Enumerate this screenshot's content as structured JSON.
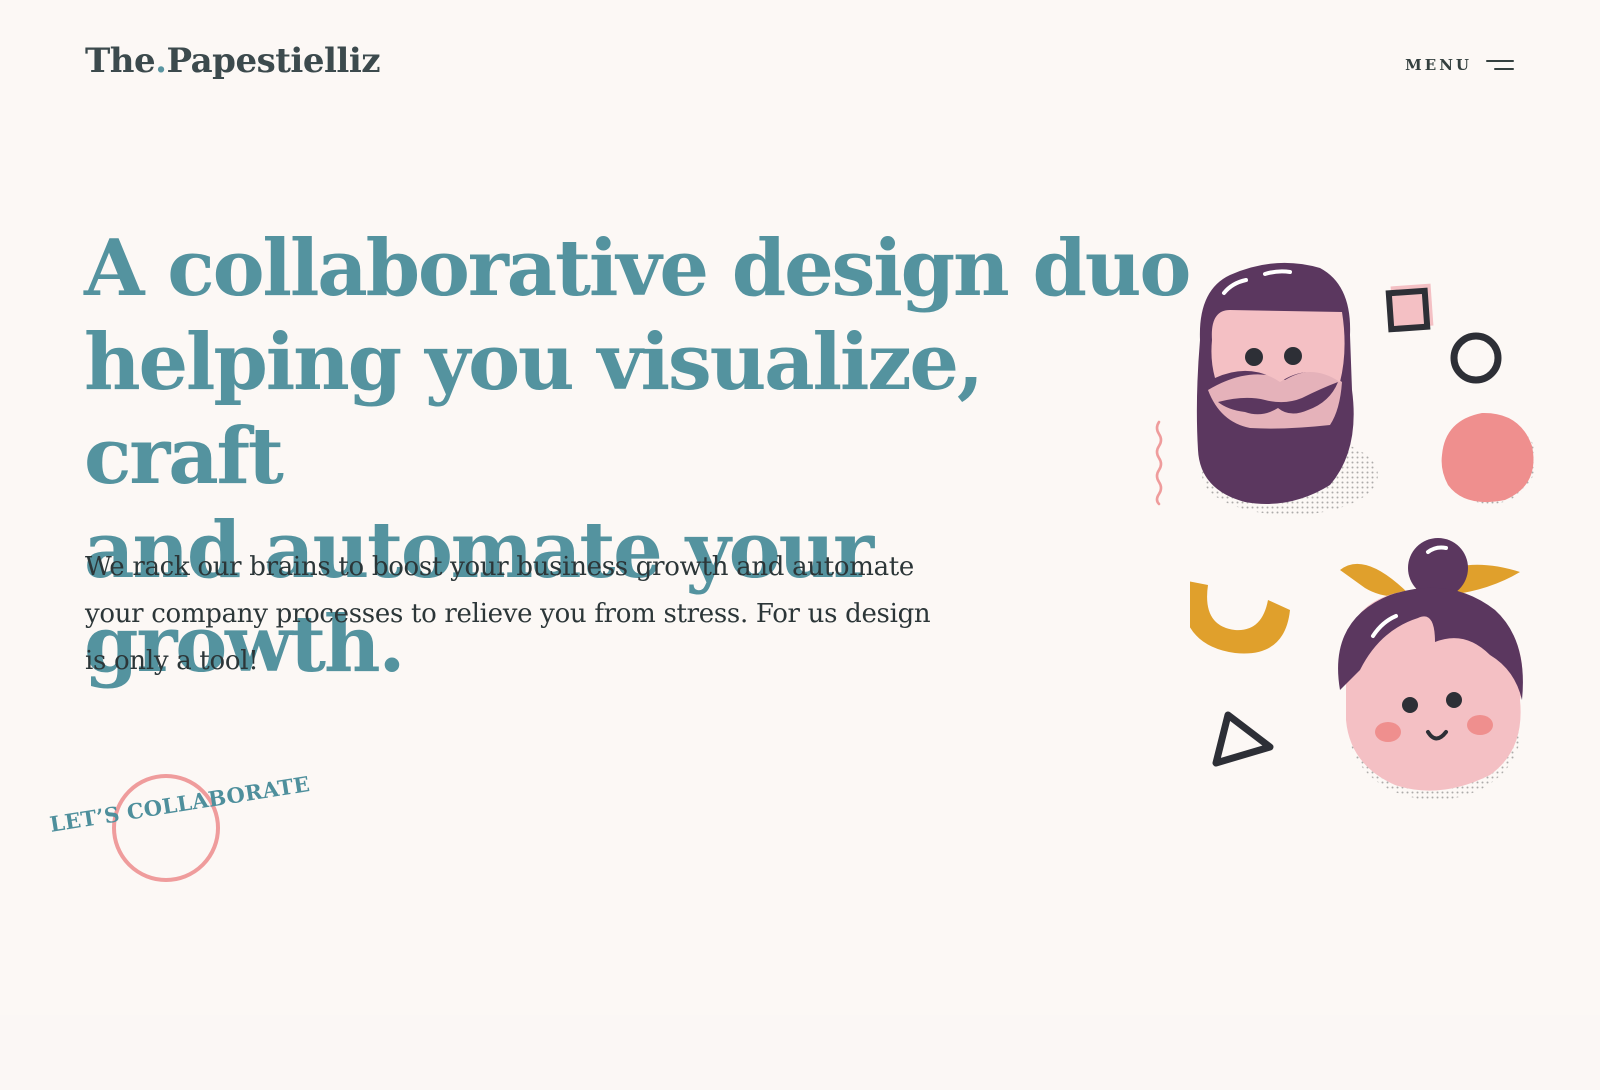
{
  "header": {
    "logo_part1": "The",
    "logo_dot": ".",
    "logo_part2": "Papestielliz",
    "menu_label": "MENU"
  },
  "hero": {
    "title_line1": "A collaborative design duo",
    "title_line2": "helping you visualize, craft",
    "title_line3": "and automate your growth.",
    "subtitle_line1": "We rack our brains to boost your business growth and automate",
    "subtitle_line2": "your company processes to relieve you from stress. For us design",
    "subtitle_line3": "is only a tool!"
  },
  "cta": {
    "label": "LET’S COLLABORATE"
  },
  "colors": {
    "background": "#fcf8f5",
    "heading": "#54939f",
    "text": "#2c3638",
    "accent_pink": "#ef9c9c",
    "purple": "#5b375f",
    "mustard": "#e0a02c",
    "skin": "#f4c0c4"
  },
  "icons": {
    "menu": "hamburger-icon",
    "illustration": "duo-faces-illustration"
  }
}
